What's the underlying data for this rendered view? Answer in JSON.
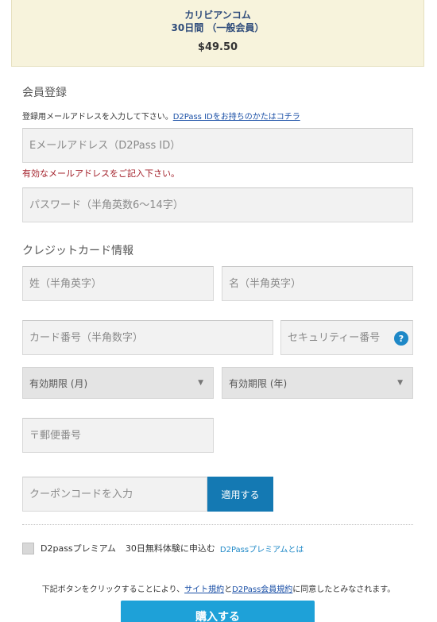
{
  "summary": {
    "site": "カリビアンコム",
    "plan": "30日間 （一般会員）",
    "price": "$49.50"
  },
  "registration": {
    "title": "会員登録",
    "note_text": "登録用メールアドレスを入力して下さい。",
    "note_link": "D2Pass IDをお持ちのかたはコチラ",
    "email_placeholder": "Eメールアドレス（D2Pass ID）",
    "email_error": "有効なメールアドレスをご記入下さい。",
    "password_placeholder": "パスワード（半角英数6〜14字）"
  },
  "credit": {
    "title": "クレジットカード情報",
    "last_name_placeholder": "姓（半角英字）",
    "first_name_placeholder": "名（半角英字）",
    "card_number_placeholder": "カード番号（半角数字）",
    "security_placeholder": "セキュリティー番号",
    "help_icon": "?",
    "expiry_month": "有効期限 (月)",
    "expiry_year": "有効期限 (年)",
    "postal_placeholder": "〒郵便番号"
  },
  "coupon": {
    "placeholder": "クーポンコードを入力",
    "apply_label": "適用する"
  },
  "premium": {
    "label": "D2passプレミアム",
    "trial": "30日無料体験に申込む",
    "link": "D2Passプレミアムとは"
  },
  "terms": {
    "before": "下記ボタンをクリックすることにより、",
    "site_terms": "サイト規約",
    "and": "と",
    "d2pass_terms": "D2Pass会員規約",
    "after": "に同意したとみなされます。"
  },
  "buy_label": "購入する",
  "colors": {
    "summary_bg": "#f7f3dc",
    "accent": "#1479b3",
    "buy_button": "#1ea1d8",
    "error": "#a3202a"
  }
}
